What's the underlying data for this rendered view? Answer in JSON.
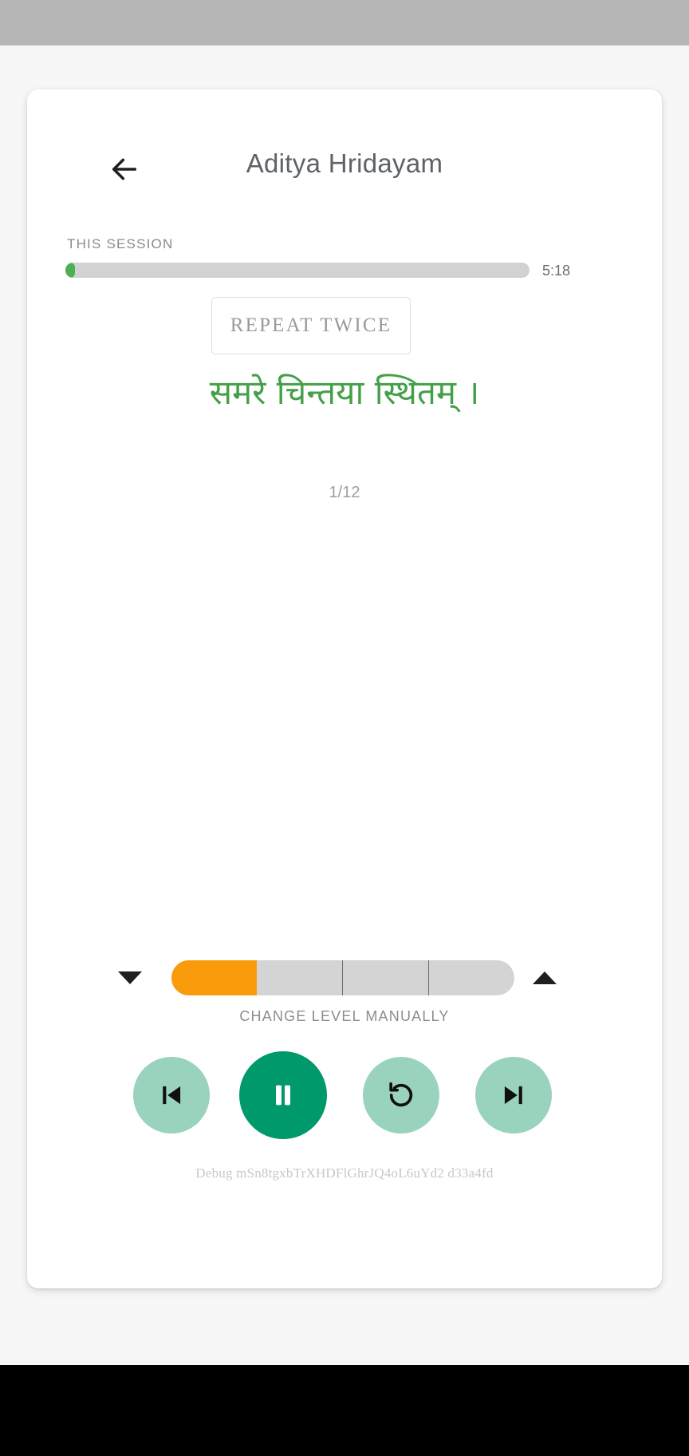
{
  "header": {
    "back_icon": "arrow-left-icon",
    "title": "Aditya Hridayam"
  },
  "session": {
    "label": "THIS SESSION",
    "progress_percent": 2,
    "time_remaining": "5:18",
    "track_color": "#d2d2d2",
    "fill_color": "#4caf50"
  },
  "repeat": {
    "label": "REPEAT TWICE"
  },
  "verse": {
    "text": "समरे चिन्तया स्थितम् ।",
    "color": "#43a047",
    "counter": "1/12"
  },
  "level": {
    "decrease_icon": "triangle-down-icon",
    "increase_icon": "triangle-up-icon",
    "segments": 4,
    "filled_segments": 1,
    "fill_color": "#f99b0b",
    "track_color": "#d4d4d4",
    "caption": "CHANGE LEVEL MANUALLY"
  },
  "controls": {
    "previous": {
      "icon": "skip-previous-icon",
      "color": "#9ad3bd"
    },
    "play_pause": {
      "icon": "pause-icon",
      "color": "#00996b",
      "state": "playing"
    },
    "replay": {
      "icon": "replay-rotate-left-icon",
      "color": "#9ad3bd"
    },
    "next": {
      "icon": "skip-next-icon",
      "color": "#9ad3bd"
    }
  },
  "debug": {
    "text": "Debug mSn8tgxbTrXHDFlGhrJQ4oL6uYd2 d33a4fd"
  }
}
